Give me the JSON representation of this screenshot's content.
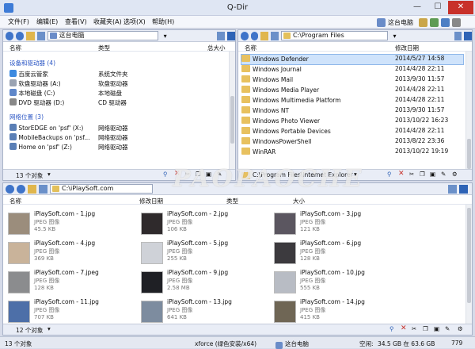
{
  "window": {
    "title": "Q-Dir",
    "minimize": "—",
    "maximize": "☐",
    "close": "✕",
    "accent": "#c8312a"
  },
  "menubar": {
    "items": [
      "文件(F)",
      "编辑(E)",
      "查看(V)",
      "收藏夹(A)",
      "选项(X)",
      "帮助(H)"
    ],
    "right_label": "这台电脑"
  },
  "pane_tl": {
    "address": "这台电脑",
    "cols": [
      "名称",
      "类型",
      "总大小"
    ],
    "group1": "设备和驱动器 (4)",
    "drives": [
      {
        "name": "百度云管家",
        "type": "系统文件夹"
      },
      {
        "name": "软盘驱动器 (A:)",
        "type": "软盘驱动器"
      },
      {
        "name": "本地磁盘 (C:)",
        "type": "本地磁盘"
      },
      {
        "name": "DVD 驱动器 (D:)",
        "type": "CD 驱动器"
      }
    ],
    "group2": "网络位置 (3)",
    "network": [
      {
        "name": "StorEDGE on 'psf' (X:)",
        "type": "网络驱动器"
      },
      {
        "name": "MobileBackups on 'psf...",
        "type": "网络驱动器"
      },
      {
        "name": "Home on 'psf' (Z:)",
        "type": "网络驱动器"
      }
    ],
    "count": "13 个对象"
  },
  "pane_tr": {
    "address": "C:\\Program Files",
    "cols": [
      "名称",
      "修改日期"
    ],
    "rows": [
      {
        "name": "Windows Defender",
        "date": "2014/5/27 14:58"
      },
      {
        "name": "Windows Journal",
        "date": "2014/4/28 22:11"
      },
      {
        "name": "Windows Mail",
        "date": "2013/9/30 11:57"
      },
      {
        "name": "Windows Media Player",
        "date": "2014/4/28 22:11"
      },
      {
        "name": "Windows Multimedia Platform",
        "date": "2014/4/28 22:11"
      },
      {
        "name": "Windows NT",
        "date": "2013/9/30 11:57"
      },
      {
        "name": "Windows Photo Viewer",
        "date": "2013/10/22 16:23"
      },
      {
        "name": "Windows Portable Devices",
        "date": "2014/4/28 22:11"
      },
      {
        "name": "WindowsPowerShell",
        "date": "2013/8/22 23:36"
      },
      {
        "name": "WinRAR",
        "date": "2013/10/22 19:19"
      }
    ],
    "bottom_path": "C:\\Program Files\\Internet Explorer"
  },
  "pane_bottom": {
    "address": "C:\\iPlaySoft.com",
    "cols": [
      "名称",
      "修改日期",
      "类型",
      "大小"
    ],
    "files": [
      {
        "name": "iPlaySoft.com - 1.jpg",
        "type": "JPEG 图像",
        "size": "45.5 KB",
        "color": "#9b8d7c"
      },
      {
        "name": "iPlaySoft.com - 2.jpg",
        "type": "JPEG 图像",
        "size": "106 KB",
        "color": "#2f2a2c"
      },
      {
        "name": "iPlaySoft.com - 3.jpg",
        "type": "JPEG 图像",
        "size": "121 KB",
        "color": "#5b5660"
      },
      {
        "name": "iPlaySoft.com - 4.jpg",
        "type": "JPEG 图像",
        "size": "369 KB",
        "color": "#c9b39a"
      },
      {
        "name": "iPlaySoft.com - 5.jpg",
        "type": "JPEG 图像",
        "size": "255 KB",
        "color": "#cfd2d8"
      },
      {
        "name": "iPlaySoft.com - 6.jpg",
        "type": "JPEG 图像",
        "size": "128 KB",
        "color": "#3c3a3e"
      },
      {
        "name": "iPlaySoft.com - 7.jpeg",
        "type": "JPEG 图像",
        "size": "128 KB",
        "color": "#8b8c8e"
      },
      {
        "name": "iPlaySoft.com - 9.jpg",
        "type": "JPEG 图像",
        "size": "2.58 MB",
        "color": "#1f2025"
      },
      {
        "name": "iPlaySoft.com - 10.jpg",
        "type": "JPEG 图像",
        "size": "555 KB",
        "color": "#b8bcc4"
      },
      {
        "name": "iPlaySoft.com - 11.jpg",
        "type": "JPEG 图像",
        "size": "707 KB",
        "color": "#4d6fa8"
      },
      {
        "name": "iPlaySoft.com - 13.jpg",
        "type": "JPEG 图像",
        "size": "641 KB",
        "color": "#7d8c9f"
      },
      {
        "name": "iPlaySoft.com - 14.jpg",
        "type": "JPEG 图像",
        "size": "415 KB",
        "color": "#6f6655"
      }
    ],
    "count": "12 个对象"
  },
  "watermark": "PAOPAOCHE",
  "status": {
    "objects": "13 个对象",
    "info": "xforce (绿色安装/x64)",
    "location": "这台电脑",
    "space_label": "空闲:",
    "space": "34.5 GB 在 63.6 GB",
    "num": "779"
  }
}
